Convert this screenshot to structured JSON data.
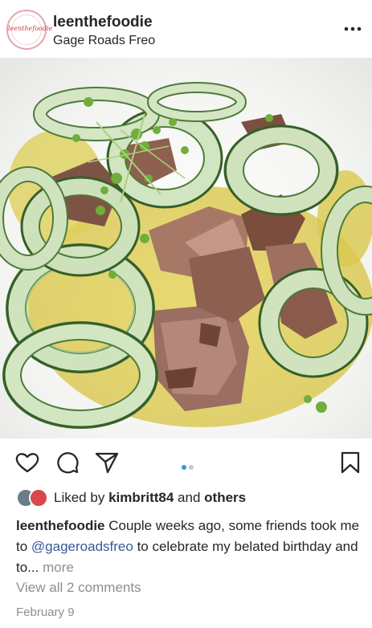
{
  "header": {
    "avatar_text": "leenthefoodie",
    "username": "leenthefoodie",
    "location": "Gage Roads Freo",
    "more_icon": "more-horizontal-icon"
  },
  "media": {
    "description_icon": "food-photo",
    "carousel_pages": 2,
    "carousel_current": 1
  },
  "actions": {
    "icons": [
      "heart-icon",
      "comment-icon",
      "share-icon",
      "bookmark-icon"
    ]
  },
  "likes": {
    "prefix": "Liked by",
    "user": "kimbritt84",
    "joiner": "and",
    "others": "others"
  },
  "caption": {
    "username": "leenthefoodie",
    "text_1": "Couple weeks ago, some friends took me to",
    "mention": "@gageroadsfreo",
    "text_2": "to celebrate my belated birthday and to...",
    "more": "more"
  },
  "comments_link": "View all 2 comments",
  "date": "February 9",
  "colors": {
    "text": "#262626",
    "secondary": "#8e8e8e",
    "mention": "#385898",
    "carousel_active": "#3b96d6"
  }
}
